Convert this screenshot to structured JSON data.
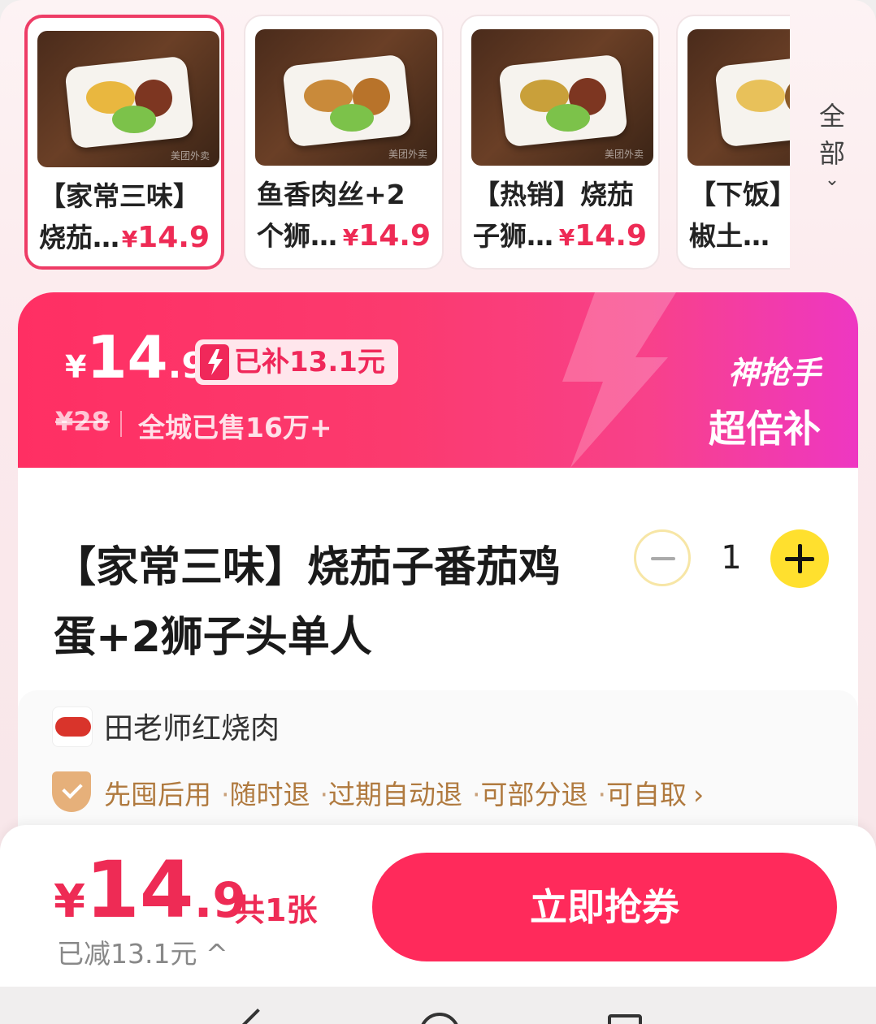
{
  "products": [
    {
      "line1": "【家常三味】",
      "line2": "烧茄…",
      "price_symbol": "¥",
      "price": "14.9",
      "watermark": "美团外卖",
      "selected": true
    },
    {
      "line1": "鱼香肉丝+2",
      "line2": "个狮…",
      "price_symbol": "¥",
      "price": "14.9",
      "watermark": "美团外卖",
      "selected": false
    },
    {
      "line1": "【热销】烧茄",
      "line2": "子狮…",
      "price_symbol": "¥",
      "price": "14.9",
      "watermark": "美团外卖",
      "selected": false
    },
    {
      "line1": "【下饭】",
      "line2": "椒土…",
      "price_symbol": "¥",
      "price": "",
      "watermark": "",
      "selected": false
    }
  ],
  "all_button": {
    "line1": "全",
    "line2": "部",
    "chevron": "⌄"
  },
  "banner": {
    "price_symbol": "¥",
    "price_int": "14",
    "price_dec": ".9",
    "subsidy_tag": "已补13.1元",
    "original_price": "¥28",
    "sold_text": "全城已售16万+",
    "brand_line1": "神抢手",
    "brand_line2": "超倍补",
    "colors": {
      "start": "#ff2f63",
      "end": "#ee37c2"
    }
  },
  "item": {
    "title": "【家常三味】烧茄子番茄鸡蛋+2狮子头单人",
    "quantity": "1"
  },
  "shop": {
    "name": "田老师红烧肉",
    "guarantees": [
      "先囤后用",
      "随时退",
      "过期自动退",
      "可部分退",
      "可自取"
    ],
    "separator": "·",
    "chevron": "›"
  },
  "checkout": {
    "price_symbol": "¥",
    "price_int": "14",
    "price_dec": ".9",
    "count_text": "共1张",
    "saved_text": "已减13.1元 ^",
    "buy_label": "立即抢券",
    "accent": "#ff2a5b"
  }
}
